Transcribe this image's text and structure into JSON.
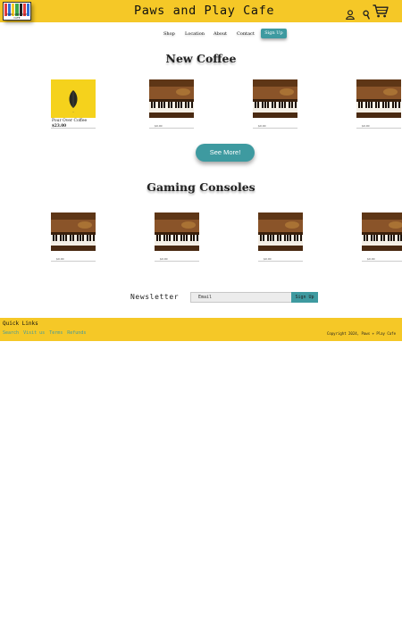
{
  "brand": {
    "title": "Paws and Play Cafe",
    "logo_text": "PAWS AND PLAY CAFE",
    "accent": "#f5c827",
    "teal": "#3e9aa0"
  },
  "header": {
    "icons": [
      "user-icon",
      "search-icon",
      "cart-icon"
    ]
  },
  "nav": {
    "items": [
      "Shop",
      "Location",
      "About",
      "Contact"
    ],
    "signup_label": "Sign Up"
  },
  "new_coffee": {
    "title": "New Coffee",
    "products": [
      {
        "name": "Pour Over Coffee",
        "price": "$23.00",
        "image": "coffee-leaf"
      },
      {
        "name": "",
        "price": "",
        "small_price": "$0.00",
        "image": "piano"
      },
      {
        "name": "",
        "price": "",
        "small_price": "$0.00",
        "image": "piano"
      },
      {
        "name": "",
        "price": "",
        "small_price": "$0.00",
        "image": "piano"
      }
    ],
    "see_more_label": "See More!"
  },
  "gaming_consoles": {
    "title": "Gaming Consoles",
    "products": [
      {
        "small_price": "$0.00",
        "image": "piano"
      },
      {
        "small_price": "$0.00",
        "image": "piano"
      },
      {
        "small_price": "$0.00",
        "image": "piano"
      },
      {
        "small_price": "$0.00",
        "image": "piano"
      }
    ]
  },
  "newsletter": {
    "label": "Newsletter",
    "email_placeholder": "Email",
    "signup_label": "Sign Up"
  },
  "footer": {
    "quick_links_title": "Quick Links",
    "links": [
      "Search",
      "Visit us",
      "Terms",
      "Refunds"
    ],
    "copyright": "Copyright 2024, Paws + Play Cafe"
  }
}
